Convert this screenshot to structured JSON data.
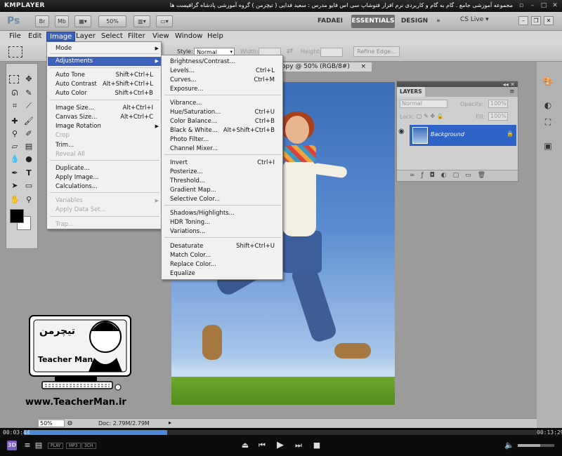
{
  "kmplayer": {
    "logo": "KMPLAYER",
    "title": "مجموعه آموزشی جامع . گام به گام و کاربردی نرم افزار فتوشاپ سی اس فایو   مدرس : سعید فدایی ( تیچرمن ) گروه آموزشی پادشاه گرافیست ها",
    "time_elapsed": "00:03:44",
    "time_total": "00:13:29",
    "progress_fraction": 0.28,
    "volume_fraction": 0.62,
    "tags": [
      "PLAY",
      "MP3",
      "3CH"
    ]
  },
  "photoshop": {
    "logo": "Ps",
    "app_buttons": [
      "Br",
      "Mb"
    ],
    "zoom_select": "50%",
    "workspaces": {
      "fadaei": "FADAEI",
      "essentials": "ESSENTIALS",
      "design": "DESIGN",
      "more": "»"
    },
    "cs_live": "CS Live ▾"
  },
  "menubar": [
    "File",
    "Edit",
    "Image",
    "Layer",
    "Select",
    "Filter",
    "View",
    "Window",
    "Help"
  ],
  "options": {
    "style_label": "Style:",
    "style_value": "Normal",
    "width_label": "Width:",
    "height_label": "Height:",
    "refine_edge": "Refine Edge..."
  },
  "document": {
    "tab_title": "opy @ 50% (RGB/8#)",
    "tab_close": "×",
    "zoom": "50%",
    "doc_size": "Doc: 2.79M/2.79M"
  },
  "image_menu": [
    {
      "label": "Mode",
      "shortcut": "",
      "sub": true,
      "disabled": false
    },
    {
      "label": "Adjustments",
      "shortcut": "",
      "sub": true,
      "disabled": false,
      "selected": true
    },
    {
      "label": "Auto Tone",
      "shortcut": "Shift+Ctrl+L"
    },
    {
      "label": "Auto Contrast",
      "shortcut": "Alt+Shift+Ctrl+L"
    },
    {
      "label": "Auto Color",
      "shortcut": "Shift+Ctrl+B"
    },
    {
      "label": "Image Size...",
      "shortcut": "Alt+Ctrl+I"
    },
    {
      "label": "Canvas Size...",
      "shortcut": "Alt+Ctrl+C"
    },
    {
      "label": "Image Rotation",
      "shortcut": "",
      "sub": true
    },
    {
      "label": "Crop",
      "shortcut": "",
      "disabled": true
    },
    {
      "label": "Trim...",
      "shortcut": ""
    },
    {
      "label": "Reveal All",
      "shortcut": "",
      "disabled": true
    },
    {
      "label": "Duplicate...",
      "shortcut": ""
    },
    {
      "label": "Apply Image...",
      "shortcut": ""
    },
    {
      "label": "Calculations...",
      "shortcut": ""
    },
    {
      "label": "Variables",
      "shortcut": "",
      "sub": true,
      "disabled": true
    },
    {
      "label": "Apply Data Set...",
      "shortcut": "",
      "disabled": true
    },
    {
      "label": "Trap...",
      "shortcut": "",
      "disabled": true
    }
  ],
  "adjustments_menu": [
    {
      "label": "Brightness/Contrast...",
      "shortcut": ""
    },
    {
      "label": "Levels...",
      "shortcut": "Ctrl+L"
    },
    {
      "label": "Curves...",
      "shortcut": "Ctrl+M"
    },
    {
      "label": "Exposure...",
      "shortcut": ""
    },
    {
      "label": "Vibrance...",
      "shortcut": ""
    },
    {
      "label": "Hue/Saturation...",
      "shortcut": "Ctrl+U"
    },
    {
      "label": "Color Balance...",
      "shortcut": "Ctrl+B"
    },
    {
      "label": "Black & White...",
      "shortcut": "Alt+Shift+Ctrl+B"
    },
    {
      "label": "Photo Filter...",
      "shortcut": ""
    },
    {
      "label": "Channel Mixer...",
      "shortcut": ""
    },
    {
      "label": "Invert",
      "shortcut": "Ctrl+I"
    },
    {
      "label": "Posterize...",
      "shortcut": ""
    },
    {
      "label": "Threshold...",
      "shortcut": ""
    },
    {
      "label": "Gradient Map...",
      "shortcut": ""
    },
    {
      "label": "Selective Color...",
      "shortcut": ""
    },
    {
      "label": "Shadows/Highlights...",
      "shortcut": ""
    },
    {
      "label": "HDR Toning...",
      "shortcut": ""
    },
    {
      "label": "Variations...",
      "shortcut": ""
    },
    {
      "label": "Desaturate",
      "shortcut": "Shift+Ctrl+U"
    },
    {
      "label": "Match Color...",
      "shortcut": ""
    },
    {
      "label": "Replace Color...",
      "shortcut": ""
    },
    {
      "label": "Equalize",
      "shortcut": ""
    }
  ],
  "layers": {
    "tab": "LAYERS",
    "blend_mode": "Normal",
    "opacity_label": "Opacity:",
    "opacity_value": "100%",
    "lock_label": "Lock:",
    "fill_label": "Fill:",
    "fill_value": "100%",
    "layer_name": "Background"
  },
  "watermark": {
    "url": "www.TeacherMan.ir",
    "name": "Teacher Man"
  },
  "colors": {
    "menu_highlight": "#3c63b9",
    "kmp_progress": "#4b8ad6"
  }
}
